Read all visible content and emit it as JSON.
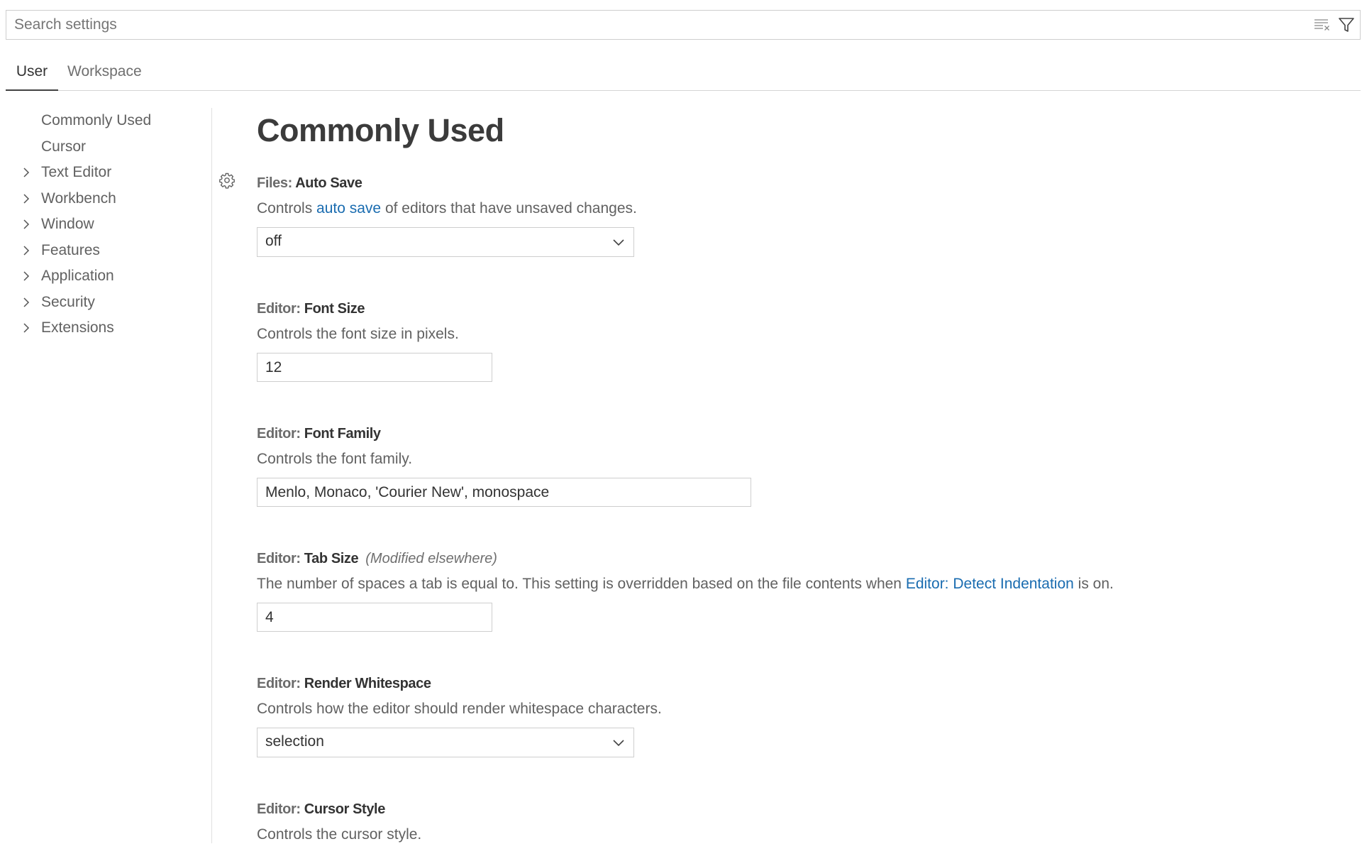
{
  "search": {
    "placeholder": "Search settings",
    "value": "",
    "clear_icon": "clear-filter-icon",
    "filter_icon": "filter-icon"
  },
  "tabs": [
    {
      "label": "User",
      "active": true
    },
    {
      "label": "Workspace",
      "active": false
    }
  ],
  "toc": {
    "items": [
      {
        "label": "Commonly Used",
        "expandable": false
      },
      {
        "label": "Cursor",
        "expandable": false
      },
      {
        "label": "Text Editor",
        "expandable": true
      },
      {
        "label": "Workbench",
        "expandable": true
      },
      {
        "label": "Window",
        "expandable": true
      },
      {
        "label": "Features",
        "expandable": true
      },
      {
        "label": "Application",
        "expandable": true
      },
      {
        "label": "Security",
        "expandable": true
      },
      {
        "label": "Extensions",
        "expandable": true
      }
    ]
  },
  "main": {
    "section_title": "Commonly Used",
    "settings": [
      {
        "category": "Files: ",
        "key": "Auto Save",
        "desc_before": "Controls ",
        "desc_link": "auto save",
        "desc_after": " of editors that have unsaved changes.",
        "control": "select",
        "value": "off"
      },
      {
        "category": "Editor: ",
        "key": "Font Size",
        "desc": "Controls the font size in pixels.",
        "control": "text",
        "value": "12"
      },
      {
        "category": "Editor: ",
        "key": "Font Family",
        "desc": "Controls the font family.",
        "control": "text",
        "value": "Menlo, Monaco, 'Courier New', monospace"
      },
      {
        "category": "Editor: ",
        "key": "Tab Size",
        "modified": "(Modified elsewhere)",
        "desc_before": "The number of spaces a tab is equal to. This setting is overridden based on the file contents when ",
        "desc_link": "Editor: Detect Indentation",
        "desc_after": " is on.",
        "control": "text",
        "value": "4"
      },
      {
        "category": "Editor: ",
        "key": "Render Whitespace",
        "desc": "Controls how the editor should render whitespace characters.",
        "control": "select",
        "value": "selection"
      },
      {
        "category": "Editor: ",
        "key": "Cursor Style",
        "desc": "Controls the cursor style."
      }
    ]
  },
  "colors": {
    "link": "#1a6cb0",
    "border": "#cecece",
    "active_tab_underline": "#424242"
  }
}
